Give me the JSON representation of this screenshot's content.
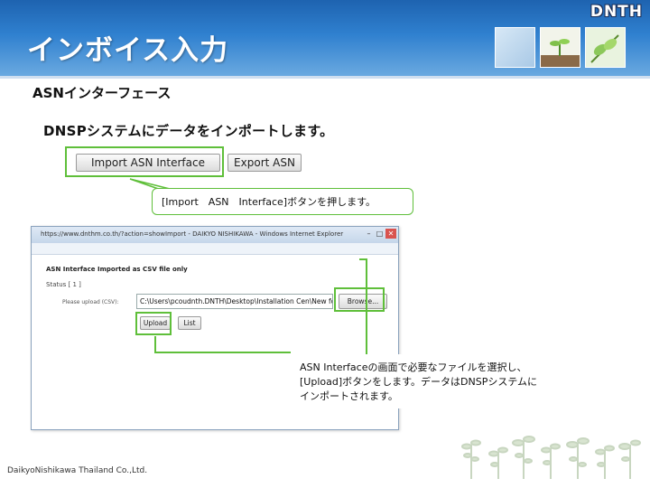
{
  "header": {
    "title": "インボイス入力",
    "brand": "DNTH"
  },
  "section": {
    "heading": "ASNインターフェース",
    "description": "DNSPシステムにデータをインポートします。"
  },
  "buttons": {
    "import_label": "Import ASN Interface",
    "export_label": "Export ASN"
  },
  "callout1": {
    "text": "[Import　ASN　Interface]ボタンを押します。"
  },
  "browser": {
    "title": "https://www.dnthm.co.th/?action=showImport - DAIKYO NISHIKAWA - Windows Internet Explorer",
    "page_heading": "ASN Interface Imported as CSV file only",
    "status_label": "Status [ 1 ]",
    "file_label": "Please upload (CSV):",
    "file_path": "C:\\Users\\pcoudnth.DNTH\\Desktop\\Installation Cen\\New fol",
    "browse_label": "Browse...",
    "upload_label": "Upload",
    "list_label": "List"
  },
  "callout2": {
    "line1": "ASN Interfaceの画面で必要なファイルを選択し、",
    "line2": "[Upload]ボタンをします。データはDNSPシステムに",
    "line3": "インポートされます。"
  },
  "footer": {
    "company": "DaikyoNishikawa Thailand Co.,Ltd."
  },
  "colors": {
    "header_blue": "#2f80cf",
    "highlight_green": "#5fbf3a"
  }
}
